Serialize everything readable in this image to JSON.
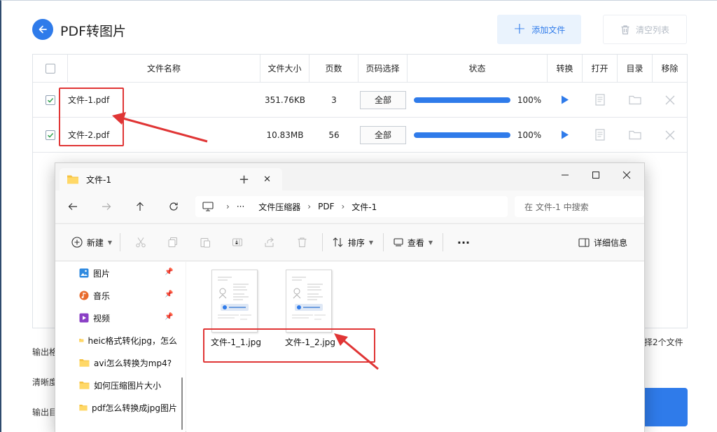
{
  "app": {
    "title": "PDF转图片",
    "add_label": "添加文件",
    "clear_label": "清空列表",
    "accent": "#2f7bea"
  },
  "table": {
    "headers": [
      "文件名称",
      "文件大小",
      "页数",
      "页码选择",
      "状态",
      "转换",
      "打开",
      "目录",
      "移除"
    ],
    "rows": [
      {
        "name": "文件-1.pdf",
        "size": "351.76KB",
        "pages": "3",
        "range": "全部",
        "progress": 1.0,
        "pct": "100%",
        "checked": true
      },
      {
        "name": "文件-2.pdf",
        "size": "10.83MB",
        "pages": "56",
        "range": "全部",
        "progress": 1.0,
        "pct": "100%",
        "checked": true
      }
    ]
  },
  "bottom": {
    "label1": "输出格",
    "label2": "清晰度",
    "label3": "输出目",
    "selected": "择2个文件"
  },
  "explorer": {
    "tab_title": "文件-1",
    "path": [
      "文件压缩器",
      "PDF",
      "文件-1"
    ],
    "search_placeholder": "在 文件-1 中搜索",
    "toolbar": {
      "new": "新建",
      "sort": "排序",
      "view": "查看",
      "details": "详细信息"
    },
    "sidebar": [
      {
        "label": "图片",
        "icon": "pictures-icon",
        "pinned": true
      },
      {
        "label": "音乐",
        "icon": "music-icon",
        "pinned": true
      },
      {
        "label": "视频",
        "icon": "video-icon",
        "pinned": true
      },
      {
        "label": "heic格式转化jpg，怎么",
        "icon": "folder-icon",
        "pinned": false
      },
      {
        "label": "avi怎么转换为mp4?",
        "icon": "folder-icon",
        "pinned": false
      },
      {
        "label": "如何压缩图片大小",
        "icon": "folder-icon",
        "pinned": false
      },
      {
        "label": "pdf怎么转换成jpg图片",
        "icon": "folder-icon",
        "pinned": false
      }
    ],
    "files": [
      {
        "name": "文件-1_1.jpg"
      },
      {
        "name": "文件-1_2.jpg"
      }
    ]
  }
}
